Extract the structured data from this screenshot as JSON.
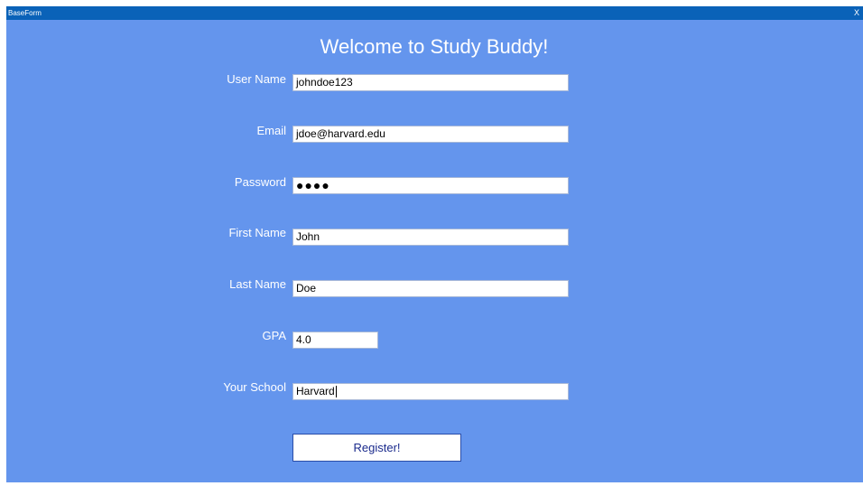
{
  "window": {
    "title": "BaseForm",
    "close_glyph": "X"
  },
  "heading": "Welcome to Study Buddy!",
  "form": {
    "username": {
      "label": "User Name",
      "value": "johndoe123"
    },
    "email": {
      "label": "Email",
      "value": "jdoe@harvard.edu"
    },
    "password": {
      "label": "Password",
      "masked_value": "●●●●"
    },
    "first_name": {
      "label": "First Name",
      "value": "John"
    },
    "last_name": {
      "label": "Last Name",
      "value": "Doe"
    },
    "gpa": {
      "label": "GPA",
      "value": "4.0"
    },
    "school": {
      "label": "Your School",
      "value": "Harvard"
    }
  },
  "register_button": {
    "label": "Register!"
  },
  "colors": {
    "background": "#6495ed",
    "titlebar": "#0a62b8",
    "button_text": "#1a2a8c"
  }
}
